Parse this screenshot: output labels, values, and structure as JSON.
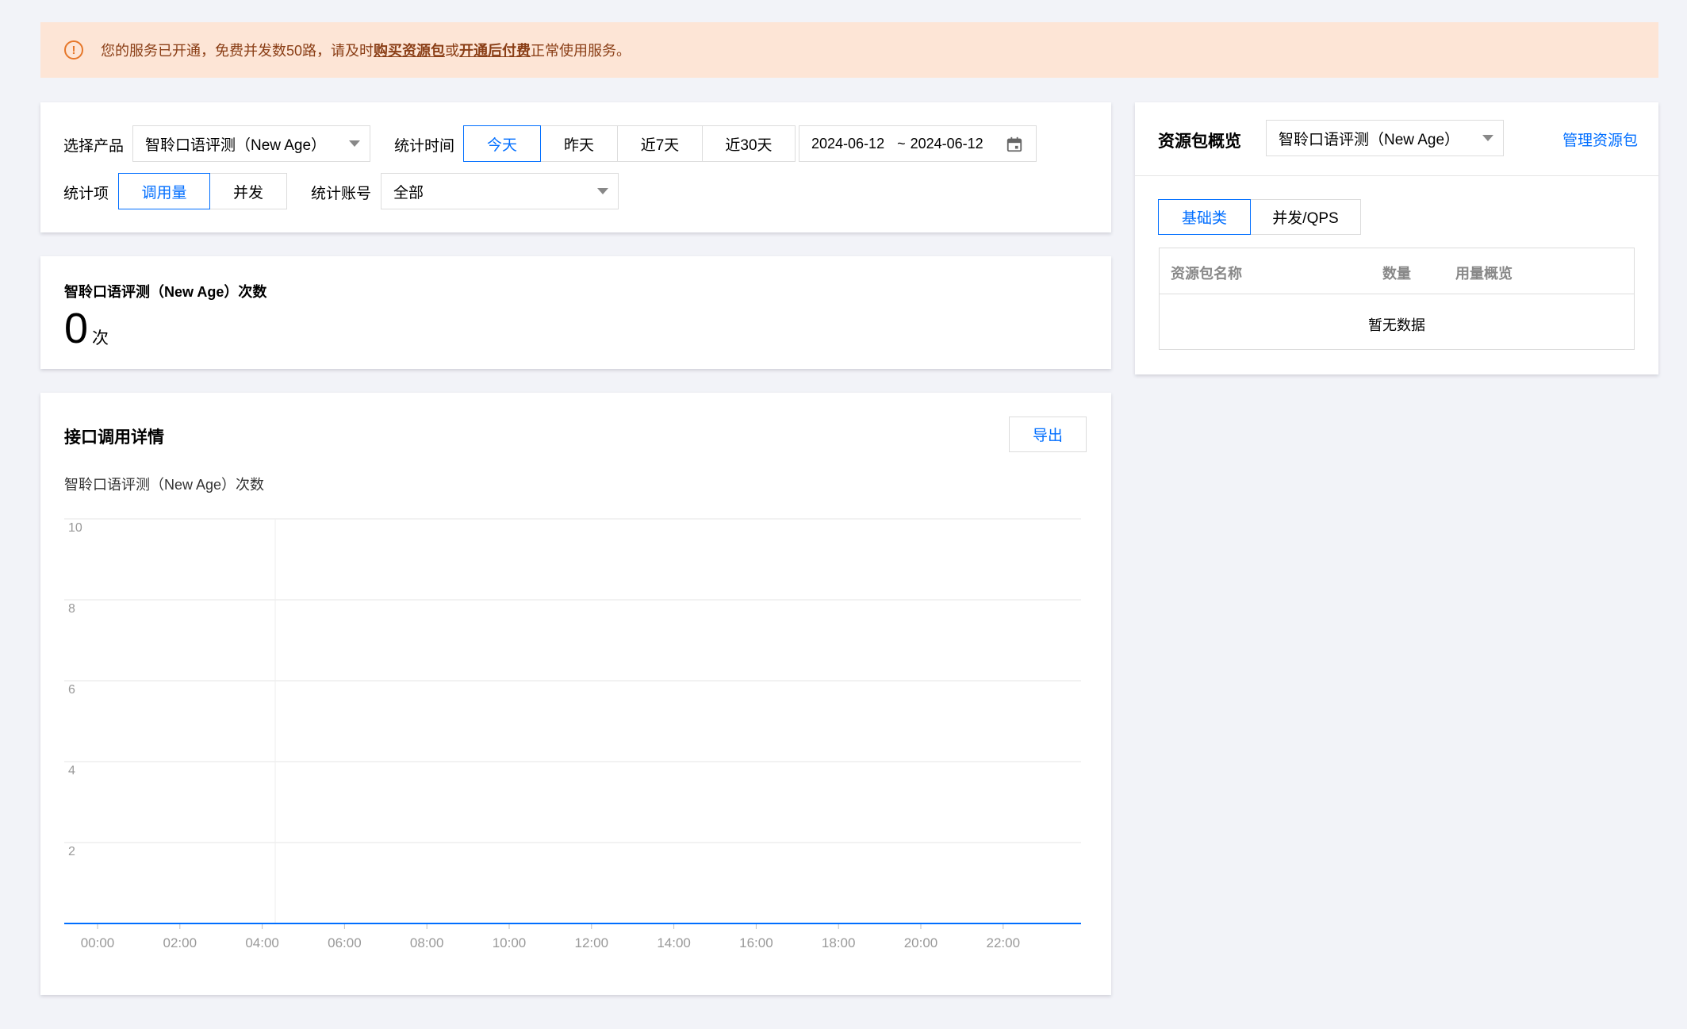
{
  "notice": {
    "icon": "warning-circle-icon",
    "text_before": "您的服务已开通，免费并发数50路，请及时",
    "link_buy": "购买资源包",
    "text_or": "或",
    "link_postpay": "开通后付费",
    "text_after": "正常使用服务。"
  },
  "filters": {
    "product_label": "选择产品",
    "product_value": "智聆口语评测（New Age）",
    "time_label": "统计时间",
    "time_options": [
      "今天",
      "昨天",
      "近7天",
      "近30天"
    ],
    "time_selected": "今天",
    "date_start": "2024-06-12",
    "date_sep": "~",
    "date_end": "2024-06-12",
    "item_label": "统计项",
    "item_options": [
      "调用量",
      "并发"
    ],
    "item_selected": "调用量",
    "account_label": "统计账号",
    "account_value": "全部"
  },
  "summary": {
    "title": "智聆口语评测（New Age）次数",
    "value": "0",
    "unit": "次"
  },
  "detail": {
    "title": "接口调用详情",
    "export_label": "导出",
    "chart_caption": "智聆口语评测（New Age）次数"
  },
  "chart_data": {
    "type": "line",
    "title": "",
    "x": [
      "00:00",
      "02:00",
      "04:00",
      "06:00",
      "08:00",
      "10:00",
      "12:00",
      "14:00",
      "16:00",
      "18:00",
      "20:00",
      "22:00"
    ],
    "series": [
      {
        "values": [
          0,
          0,
          0,
          0,
          0,
          0,
          0,
          0,
          0,
          0,
          0,
          0
        ]
      }
    ],
    "yticks": [
      2,
      4,
      6,
      8,
      10
    ],
    "ylim": [
      0,
      10
    ],
    "grid": true,
    "color": "#006eff"
  },
  "resource": {
    "title": "资源包概览",
    "product_value": "智聆口语评测（New Age）",
    "manage_link": "管理资源包",
    "tabs": [
      "基础类",
      "并发/QPS"
    ],
    "tab_selected": "基础类",
    "columns": [
      "资源包名称",
      "数量",
      "用量概览"
    ],
    "empty_text": "暂无数据"
  },
  "colors": {
    "accent": "#006eff",
    "notice_bg": "#fde5d6",
    "notice_text": "#8a3e16",
    "warning": "#e6772a"
  }
}
